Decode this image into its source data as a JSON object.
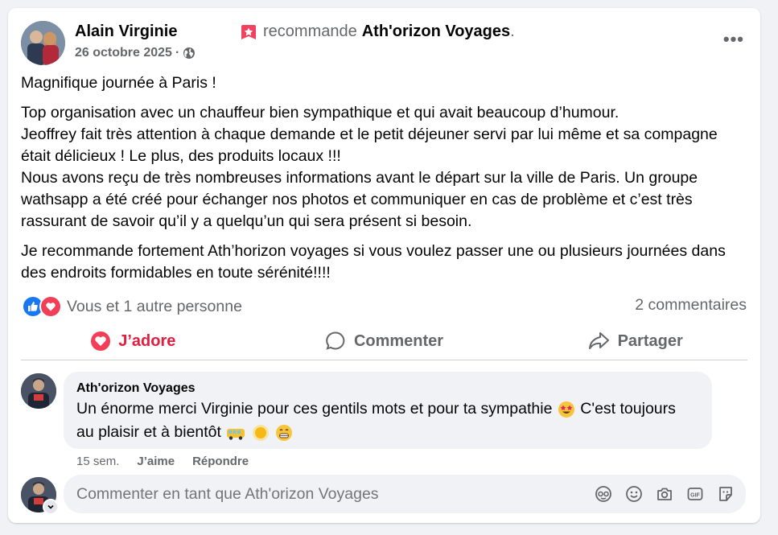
{
  "post": {
    "author": "Alain Virginie",
    "recommend_text": "recommande",
    "page_name": "Ath'orizon Voyages",
    "page_name_suffix": ".",
    "date": "26 octobre 2025",
    "meta_separator": "·",
    "privacy_icon": "globe-icon",
    "more_label": "•••",
    "paragraphs": [
      "Magnifique journée à Paris !",
      "Top organisation avec un chauffeur bien sympathique et qui avait beaucoup d’humour.\nJeoffrey fait très attention à chaque demande et le petit déjeuner servi par lui même et sa compagne était délicieux ! Le plus, des produits locaux !!!\nNous avons reçu de très nombreuses informations avant le départ sur la ville de Paris. Un groupe wathsapp a été créé pour échanger nos photos et communiquer en cas de problème et c’est très rassurant de savoir qu’il y a quelqu’un qui sera présent si besoin.",
      "Je recommande fortement Ath’horizon voyages si vous voulez passer une ou plusieurs journées dans des endroits formidables en toute sérénité!!!!"
    ],
    "reactions_text": "Vous et 1 autre personne",
    "comments_count": "2 commentaires"
  },
  "actions": {
    "love": "J’adore",
    "comment": "Commenter",
    "share": "Partager"
  },
  "comment": {
    "author": "Ath'orizon Voyages",
    "text_part1": "Un énorme merci Virginie pour ces gentils mots et pour ta sympathie",
    "text_part2": "C'est toujours au plaisir et à bientôt",
    "time": "15 sem.",
    "like_label": "J’aime",
    "reply_label": "Répondre"
  },
  "composer": {
    "placeholder": "Commenter en tant que Ath'orizon Voyages",
    "icons": [
      "avatar-sticker-icon",
      "emoji-icon",
      "camera-icon",
      "gif-icon",
      "sticker-icon"
    ]
  },
  "colors": {
    "accent_blue": "#1877f2",
    "love_red": "#e41e3f",
    "secondary_text": "#65676b",
    "bubble_bg": "#f0f2f5"
  }
}
